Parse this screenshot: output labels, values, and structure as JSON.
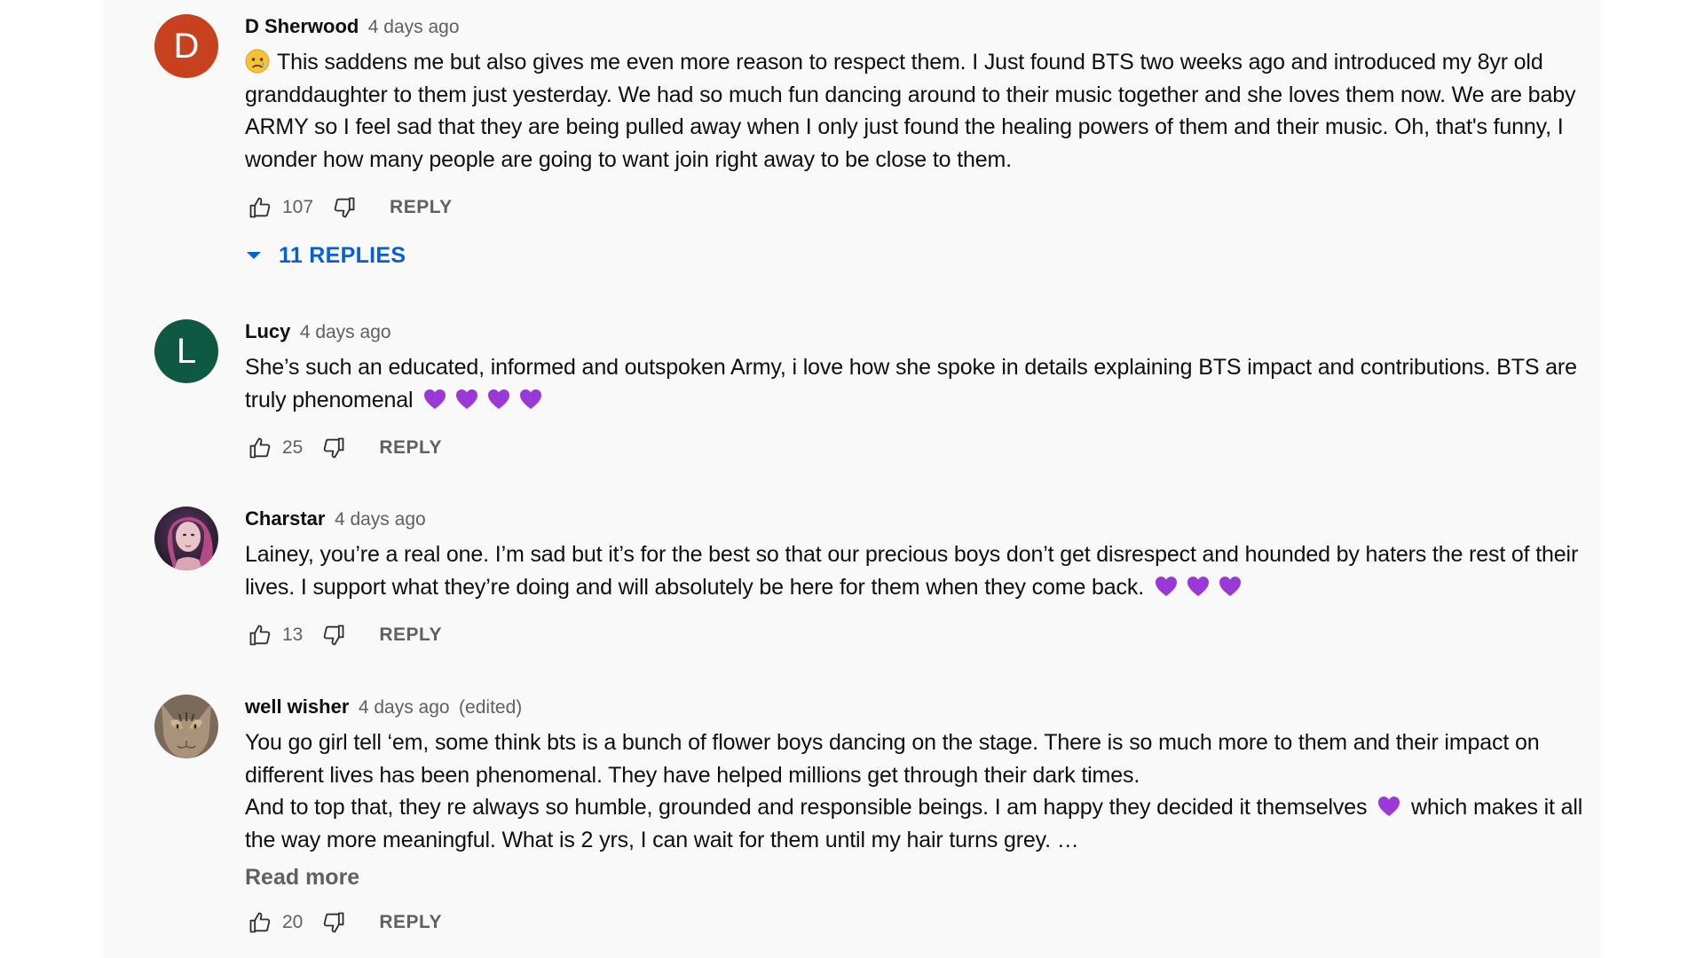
{
  "colors": {
    "avatar_d": "#c8411f",
    "avatar_l": "#0f5943",
    "link_blue": "#065fd4",
    "heart": "#9b39d6"
  },
  "comments": [
    {
      "author": "D Sherwood",
      "time": "4 days ago",
      "avatar_letter": "D",
      "text_line": "This saddens  me but also gives me even more reason to respect them. I Just found BTS two weeks ago and introduced my 8yr old granddaughter to them just yesterday. We had so much fun dancing around to their music together and she loves them now. We are baby ARMY so I feel sad that they are being pulled away when I only just found the healing powers of them and their music.  Oh, that's funny,  I wonder how many people are going to want join right away to be close to them.",
      "likes": "107",
      "reply_label": "REPLY",
      "replies_label": "11 REPLIES"
    },
    {
      "author": "Lucy",
      "time": "4 days ago",
      "avatar_letter": "L",
      "text_line": "She’s such an educated, informed and outspoken Army, i love how she spoke in details explaining BTS impact and contributions. BTS are truly phenomenal",
      "likes": "25",
      "reply_label": "REPLY"
    },
    {
      "author": "Charstar",
      "time": "4 days ago",
      "text_line": "Lainey, you’re a real one. I’m sad but it’s for the best so that our precious boys don’t get disrespect and hounded by haters the rest of their lives. I support what they’re doing and will absolutely be here for them when they come back.",
      "likes": "13",
      "reply_label": "REPLY"
    },
    {
      "author": "well wisher",
      "time": "4 days ago",
      "edited": "(edited)",
      "text_line1": "You go girl tell ‘em, some think bts is a bunch of flower boys dancing on the stage. There is so much more to them and their impact on different lives has been phenomenal. They have helped millions get through their dark times.",
      "text_line2a": "And to top that, they re always so humble, grounded and responsible beings. I am happy they decided it themselves",
      "text_line2b": "which makes it all the way more meaningful. What is 2 yrs, I can wait for them until my hair turns grey. …",
      "read_more": "Read more",
      "likes": "20",
      "reply_label": "REPLY"
    }
  ]
}
